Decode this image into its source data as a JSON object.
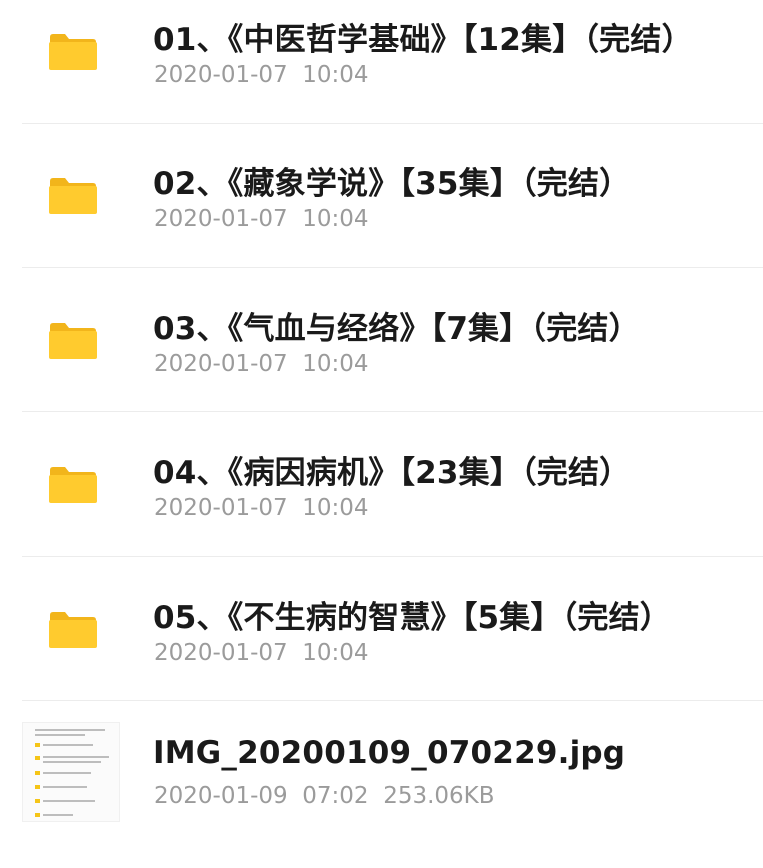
{
  "items": [
    {
      "name": "01、《中医哲学基础》【12集】（完结）",
      "meta": "2020-01-07  10:04",
      "type": "folder"
    },
    {
      "name": "02、《藏象学说》【35集】（完结）",
      "meta": "2020-01-07  10:04",
      "type": "folder"
    },
    {
      "name": "03、《气血与经络》【7集】（完结）",
      "meta": "2020-01-07  10:04",
      "type": "folder"
    },
    {
      "name": "04、《病因病机》【23集】（完结）",
      "meta": "2020-01-07  10:04",
      "type": "folder"
    },
    {
      "name": "05、《不生病的智慧》【5集】（完结）",
      "meta": "2020-01-07  10:04",
      "type": "folder"
    },
    {
      "name": "IMG_20200109_070229.jpg",
      "meta": "2020-01-09  07:02  253.06KB",
      "type": "image"
    }
  ],
  "icons": {
    "folder": "folder-icon",
    "image": "image-thumbnail"
  },
  "colors": {
    "folder": "#FFCB2E",
    "folder_tab": "#F2B51B",
    "title": "#1A1A1A",
    "meta": "#9B9B9B",
    "divider": "#ECECEC"
  }
}
